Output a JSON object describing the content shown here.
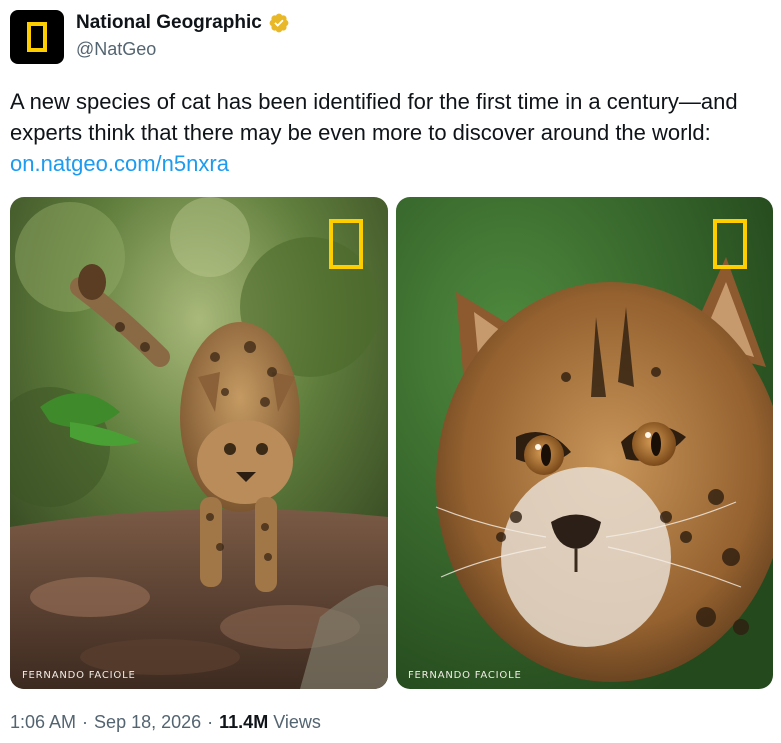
{
  "author": {
    "display_name": "National Geographic",
    "handle": "@NatGeo",
    "verified_icon": "gold-verified-badge-icon",
    "avatar_icon": "national-geographic-yellow-frame-logo"
  },
  "tweet": {
    "text": "A new species of cat has been identified for the first time in a century—and experts think that there may be even more to discover around the world: ",
    "link_text": "on.natgeo.com/n5nxra"
  },
  "media": [
    {
      "credit": "FERNANDO FACIOLE",
      "description_icon": "wild-cat-walking-photo"
    },
    {
      "credit": "FERNANDO FACIOLE",
      "description_icon": "wild-cat-closeup-photo"
    }
  ],
  "meta": {
    "time": "1:06 AM",
    "date": "Sep 18, 2026",
    "views_count": "11.4M",
    "views_label": "Views",
    "separator": "·"
  },
  "colors": {
    "brand_yellow": "#ffce00",
    "link_blue": "#1d9bf0",
    "secondary_text": "#536471"
  }
}
